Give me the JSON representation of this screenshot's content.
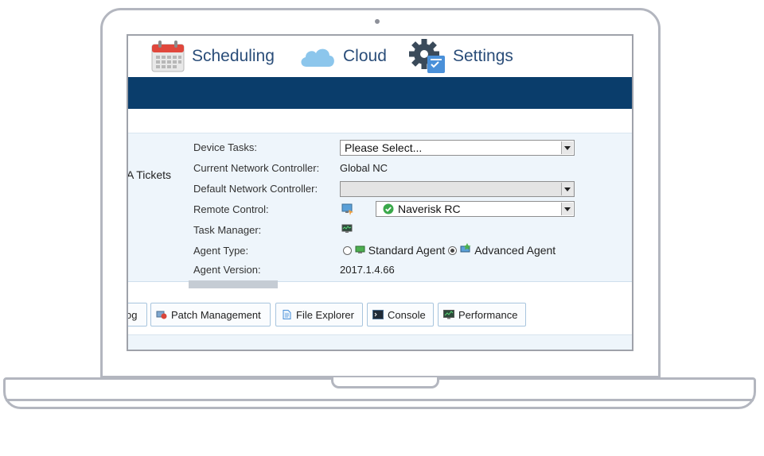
{
  "nav": {
    "scheduling": "Scheduling",
    "cloud": "Cloud",
    "settings": "Settings"
  },
  "side_tab": "A Tickets",
  "form": {
    "device_tasks_label": "Device Tasks:",
    "device_tasks_value": "Please Select...",
    "current_nc_label": "Current Network Controller:",
    "current_nc_value": "Global NC",
    "default_nc_label": "Default Network Controller:",
    "default_nc_value": "",
    "remote_control_label": "Remote Control:",
    "remote_control_value": "Naverisk RC",
    "task_manager_label": "Task Manager:",
    "agent_type_label": "Agent Type:",
    "agent_type_standard": "Standard Agent",
    "agent_type_advanced": "Advanced Agent",
    "agent_type_selected": "Advanced Agent",
    "agent_version_label": "Agent Version:",
    "agent_version_value": "2017.1.4.66"
  },
  "toolbar": {
    "log": "og",
    "patch_management": "Patch Management",
    "file_explorer": "File Explorer",
    "console": "Console",
    "performance": "Performance"
  },
  "colors": {
    "banner": "#0a3d6b",
    "nav_text": "#2a4d79",
    "panel_bg": "#eef5fb"
  }
}
